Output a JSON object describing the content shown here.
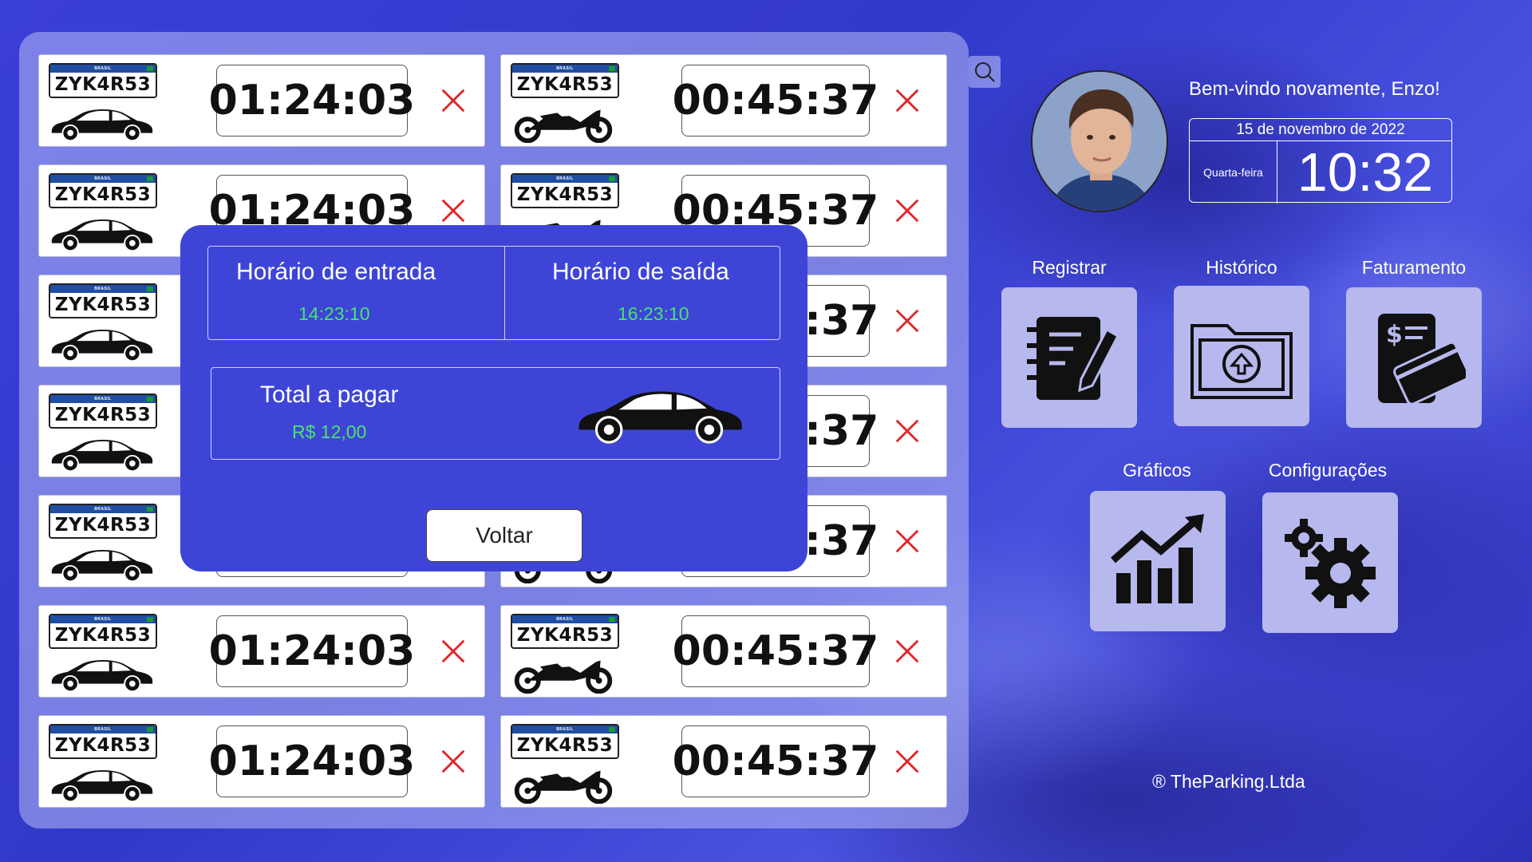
{
  "plate": {
    "country": "BRASIL",
    "number": "ZYK4R53"
  },
  "timers": {
    "left": "01:24:03",
    "right": "00:45:37"
  },
  "rows": [
    {
      "left_vehicle": "car",
      "right_vehicle": "moto"
    },
    {
      "left_vehicle": "car",
      "right_vehicle": "moto"
    },
    {
      "left_vehicle": "car",
      "right_vehicle": "moto"
    },
    {
      "left_vehicle": "car",
      "right_vehicle": "moto"
    },
    {
      "left_vehicle": "car",
      "right_vehicle": "moto"
    },
    {
      "left_vehicle": "car",
      "right_vehicle": "moto"
    },
    {
      "left_vehicle": "car",
      "right_vehicle": "moto"
    }
  ],
  "user": {
    "welcome": "Bem-vindo novamente, Enzo!"
  },
  "clock": {
    "date": "15 de novembro de 2022",
    "weekday": "Quarta-feira",
    "time": "10:32"
  },
  "menu": [
    {
      "label": "Registrar",
      "icon": "notebook-pencil-icon"
    },
    {
      "label": "Histórico",
      "icon": "folder-upload-icon"
    },
    {
      "label": "Faturamento",
      "icon": "invoice-card-icon"
    },
    {
      "label": "Gráficos",
      "icon": "chart-growth-icon"
    },
    {
      "label": "Configurações",
      "icon": "gears-icon"
    }
  ],
  "modal": {
    "entry_label": "Horário de entrada",
    "entry_time": "14:23:10",
    "exit_label": "Horário de saída",
    "exit_time": "16:23:10",
    "total_label": "Total a pagar",
    "total_value": "R$ 12,00",
    "back_label": "Voltar"
  },
  "footer": "® TheParking.Ltda",
  "colors": {
    "accent": "#3e45d6",
    "value_green": "#4be36e",
    "close_red": "#e0242a"
  }
}
